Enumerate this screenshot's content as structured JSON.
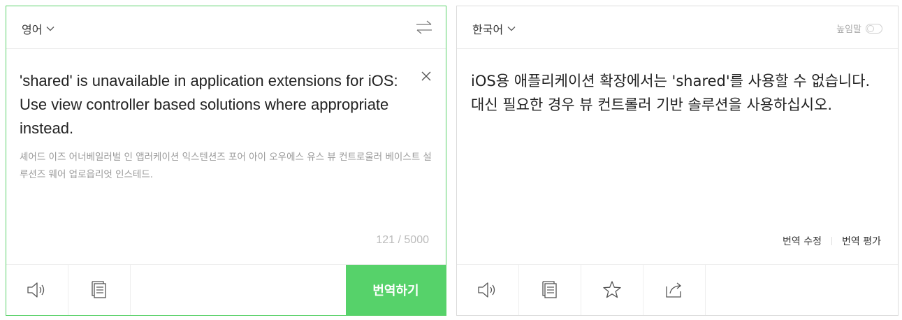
{
  "source": {
    "language": "영어",
    "text": "'shared' is unavailable in application extensions for iOS: Use view controller based solutions where appropriate instead.",
    "pronunciation": "셰어드 이즈 어너베일러벌 인 앱러케이션 익스텐션즈 포어 아이 오우에스 유스 뷰 컨트로울러 베이스트 설루션즈 웨어 업로읍리엇 인스테드.",
    "char_count": "121 / 5000",
    "translate_label": "번역하기",
    "icons": [
      "speaker-icon",
      "copy-icon",
      "swap-icon",
      "close-icon"
    ]
  },
  "target": {
    "language": "한국어",
    "honorific_label": "높임말",
    "honorific_on": false,
    "text": "iOS용 애플리케이션 확장에서는 'shared'를 사용할 수 없습니다. 대신 필요한 경우 뷰 컨트롤러 기반 솔루션을 사용하십시오.",
    "edit_label": "번역 수정",
    "rate_label": "번역 평가",
    "icons": [
      "speaker-icon",
      "copy-icon",
      "star-icon",
      "share-icon"
    ]
  },
  "colors": {
    "accent": "#56d26a",
    "source_border": "#5ad16a",
    "target_border": "#dcdcdc"
  }
}
